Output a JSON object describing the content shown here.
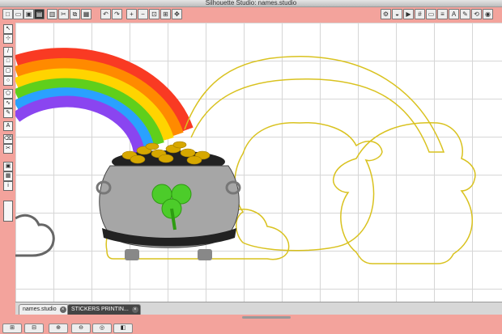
{
  "window": {
    "title": "Silhouette Studio: names.studio"
  },
  "toolbar_left": [
    "new",
    "open",
    "save",
    "library",
    "print",
    "cut",
    "copy",
    "paste",
    "undo",
    "redo",
    "zoom-in",
    "zoom-out",
    "zoom-fit",
    "zoom-select",
    "pan",
    "refresh"
  ],
  "toolbar_right": [
    "settings",
    "cut-settings",
    "send",
    "grid",
    "page",
    "align",
    "text",
    "points",
    "transform",
    "fill"
  ],
  "left_tools": [
    "pointer",
    "line",
    "rectangle",
    "ellipse",
    "polygon",
    "curve",
    "arc",
    "freehand",
    "text",
    "eraser",
    "knife",
    "page-setup",
    "transform",
    "info"
  ],
  "tabs": [
    {
      "label": "names.studio",
      "active": true
    },
    {
      "label": "STICKERS PRINTIN...",
      "active": false
    }
  ],
  "bottom_buttons": [
    "group",
    "ungroup",
    "weld",
    "subtract",
    "offset",
    "trace",
    "send-back"
  ],
  "colors": {
    "rainbow": [
      "#f93a23",
      "#ff8a00",
      "#ffd400",
      "#5fcf1b",
      "#2aa1ff",
      "#8a45f0"
    ],
    "cut_line": "#d9c21f",
    "pot": "#a6a6a6",
    "gold": "#d7a800",
    "clover": "#4ccc2a"
  }
}
